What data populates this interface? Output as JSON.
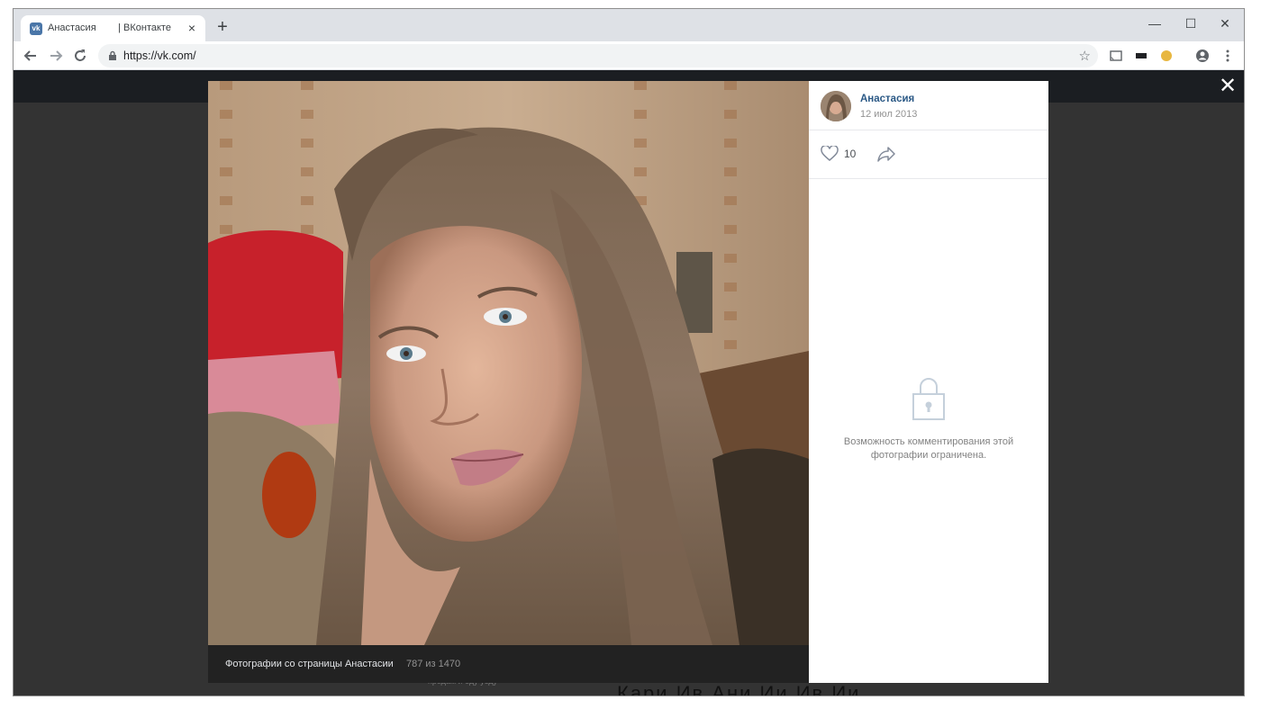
{
  "browser": {
    "tab_title": "Анастасия        | ВКонтакте",
    "favicon_label": "vk",
    "url": "https://vk.com/",
    "controls": {
      "minimize": "—",
      "maximize": "☐",
      "close": "✕"
    }
  },
  "viewer": {
    "author_name": "Анастасия",
    "post_date": "12 июл 2013",
    "likes": "10",
    "caption": "Фотографии со страницы Анастасии",
    "counter": "787 из 1470",
    "comments_restricted": "Возможность комментирования этой фотографии ограничена."
  },
  "background": {
    "snippet": "продам  и  еду уеду",
    "heading": "Кари  Ив  Ани Ии  Ив  Ии"
  },
  "icons": [
    "back-icon",
    "forward-icon",
    "reload-icon",
    "lock-icon",
    "star-icon",
    "cast-icon",
    "profile-icon",
    "menu-icon",
    "close-icon",
    "heart-icon",
    "share-icon",
    "padlock-icon"
  ],
  "colors": {
    "vk_link": "#2a5885",
    "overlay": "#333333",
    "header": "#1b1e22"
  }
}
